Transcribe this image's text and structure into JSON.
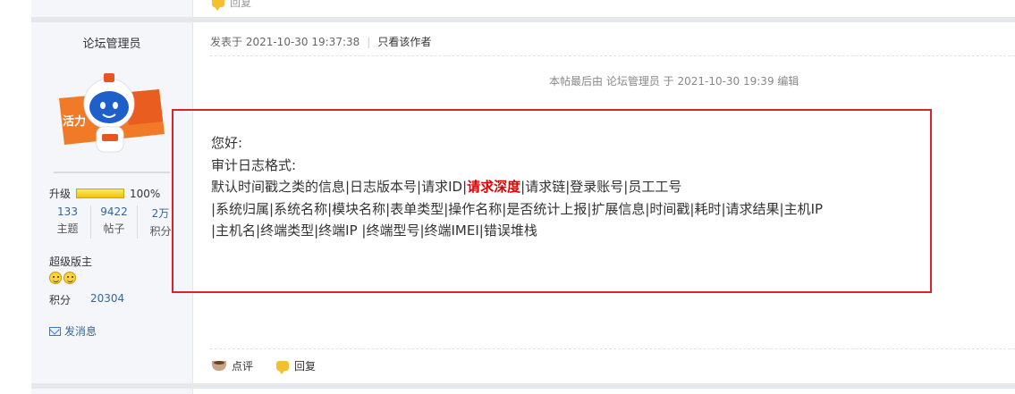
{
  "previous_post": {
    "reply_label": "回复"
  },
  "author": {
    "name": "论坛管理员",
    "avatar_text": "活力",
    "level_label": "升级",
    "level_progress_percent": 100,
    "level_progress_text": "100%",
    "stats": [
      {
        "value": "133",
        "label": "主题"
      },
      {
        "value": "9422",
        "label": "帖子"
      },
      {
        "value": "2万",
        "label": "积分"
      }
    ],
    "rank": "超级版主",
    "points_label": "积分",
    "points_value": "20304",
    "send_message_label": "发消息"
  },
  "post": {
    "posted_at": "发表于 2021-10-30 19:37:38",
    "view_author_only": "只看该作者",
    "edit_note": "本帖最后由 论坛管理员 于 2021-10-30 19:39 编辑",
    "greeting": "您好:",
    "format_title": "审计日志格式:",
    "line1_before": "默认时间戳之类的信息|日志版本号|请求ID|",
    "line1_highlight": "请求深度",
    "line1_after": "|请求链|登录账号|员工工号",
    "line2": "|系统归属|系统名称|模块名称|表单类型|操作名称|是否统计上报|扩展信息|时间戳|耗时|请求结果|主机IP",
    "line3": "|主机名|终端类型|终端IP |终端型号|终端IMEI|错误堆栈",
    "rate_label": "点评",
    "reply_label": "回复"
  },
  "colors": {
    "highlight": "#e00000",
    "annotation_box": "#d9242b",
    "link": "#336699"
  }
}
